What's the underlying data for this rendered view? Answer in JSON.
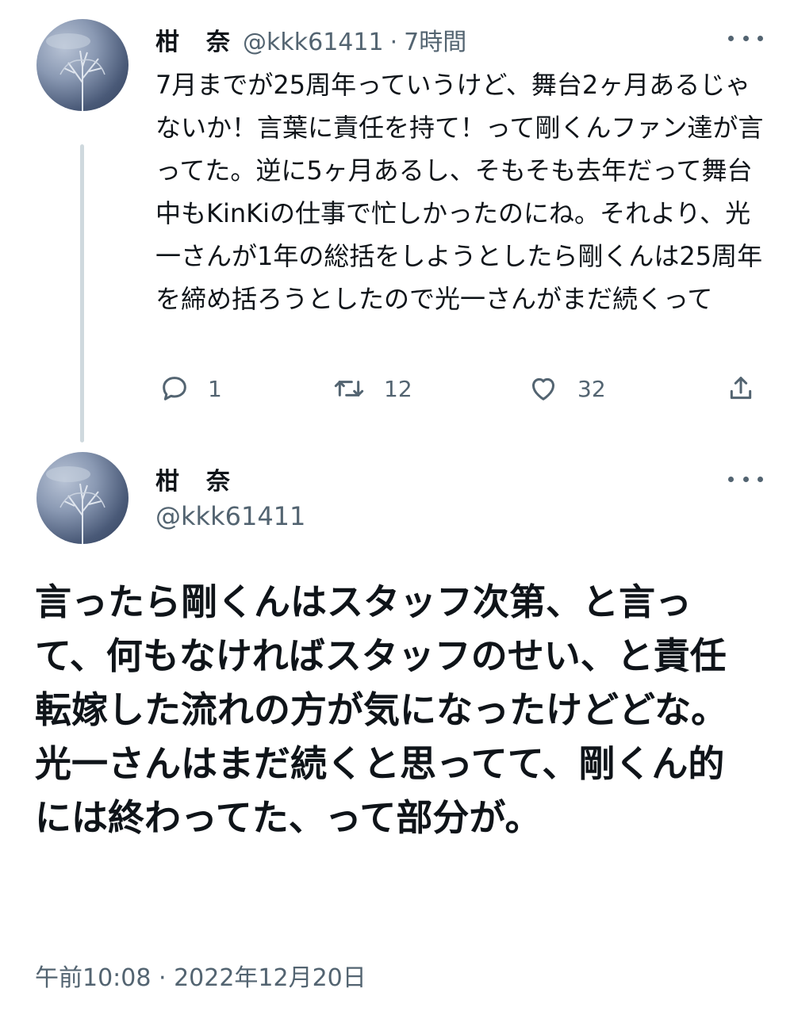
{
  "tweet1": {
    "name": "柑　奈",
    "handle": "@kkk61411",
    "separator": "·",
    "time": "7時間",
    "text": "7月までが25周年っていうけど、舞台2ヶ月あるじゃないか！言葉に責任を持て！って剛くんファン達が言ってた。逆に5ヶ月あるし、そもそも去年だって舞台中もKinKiの仕事で忙しかったのにね。それより、光一さんが1年の総括をしようとしたら剛くんは25周年を締め括ろうとしたので光一さんがまだ続くって",
    "actions": {
      "reply_count": "1",
      "retweet_count": "12",
      "like_count": "32"
    }
  },
  "tweet2": {
    "name": "柑　奈",
    "handle": "@kkk61411",
    "text": "言ったら剛くんはスタッフ次第、と言って、何もなければスタッフのせい、と責任転嫁した流れの方が気になったけどどな。光一さんはまだ続くと思ってて、剛くん的には終わってた、って部分が。",
    "timestamp": "午前10:08 · 2022年12月20日"
  },
  "icons": [
    "avatar",
    "more-icon",
    "reply-icon",
    "retweet-icon",
    "like-icon",
    "share-icon"
  ],
  "colors": {
    "text": "#0f1419",
    "muted": "#536471",
    "thread_line": "#cfd9de"
  }
}
